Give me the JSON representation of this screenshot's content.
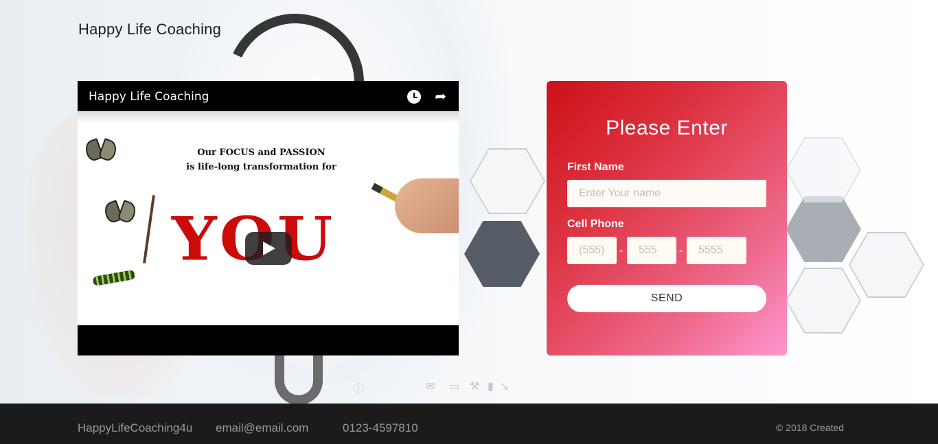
{
  "site": {
    "brand": "Happy Life Coaching"
  },
  "video": {
    "title": "Happy Life Coaching",
    "thumbnail_caption_line1": "Our FOCUS and PASSION",
    "thumbnail_caption_line2": "is life-long transformation for",
    "thumbnail_big_word": "YOU",
    "icons": [
      "watch-later-icon",
      "share-icon",
      "play-icon"
    ]
  },
  "form": {
    "heading": "Please Enter",
    "first_name_label": "First Name",
    "first_name_placeholder": "Enter Your name",
    "phone_label": "Cell Phone",
    "phone_area_placeholder": "(555)",
    "phone_prefix_placeholder": "555",
    "phone_line_placeholder": "5555",
    "phone_separator": "-",
    "submit_label": "SEND",
    "gradient_start": "#cc1119",
    "gradient_end": "#fd98cf"
  },
  "footer": {
    "site_name": "HappyLifeCoaching4u",
    "email": "email@email.com",
    "phone": "0123-4597810",
    "copyright": "© 2018 Created"
  }
}
